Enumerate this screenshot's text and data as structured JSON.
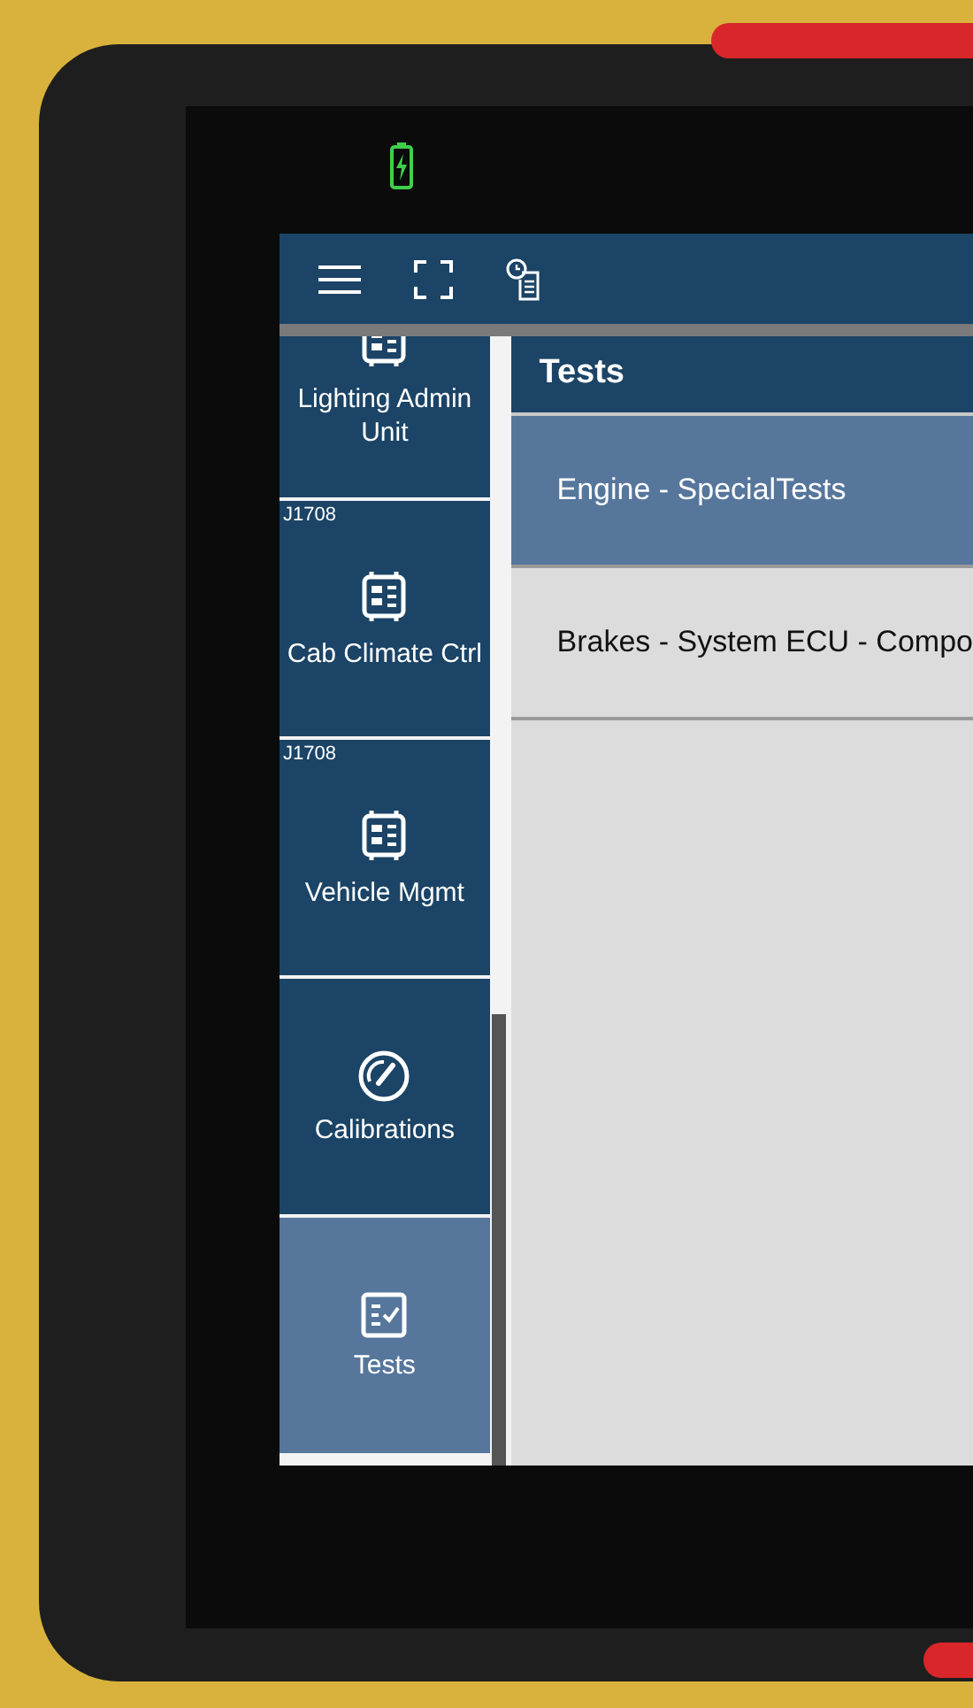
{
  "sidebar": {
    "items": [
      {
        "kind": "module",
        "label": "Lighting Admin Unit",
        "selected": false
      },
      {
        "kind": "module",
        "protocol": "J1708",
        "label": "Cab Climate Ctrl",
        "selected": false
      },
      {
        "kind": "module",
        "protocol": "J1708",
        "label": "Vehicle Mgmt",
        "selected": false
      },
      {
        "kind": "gauge",
        "label": "Calibrations",
        "selected": false
      },
      {
        "kind": "checklist",
        "label": "Tests",
        "selected": true
      }
    ]
  },
  "panel": {
    "title": "Tests",
    "rows": [
      {
        "label": "Engine - SpecialTests",
        "selected": true
      },
      {
        "label": "Brakes - System ECU - Compo",
        "selected": false
      }
    ]
  }
}
